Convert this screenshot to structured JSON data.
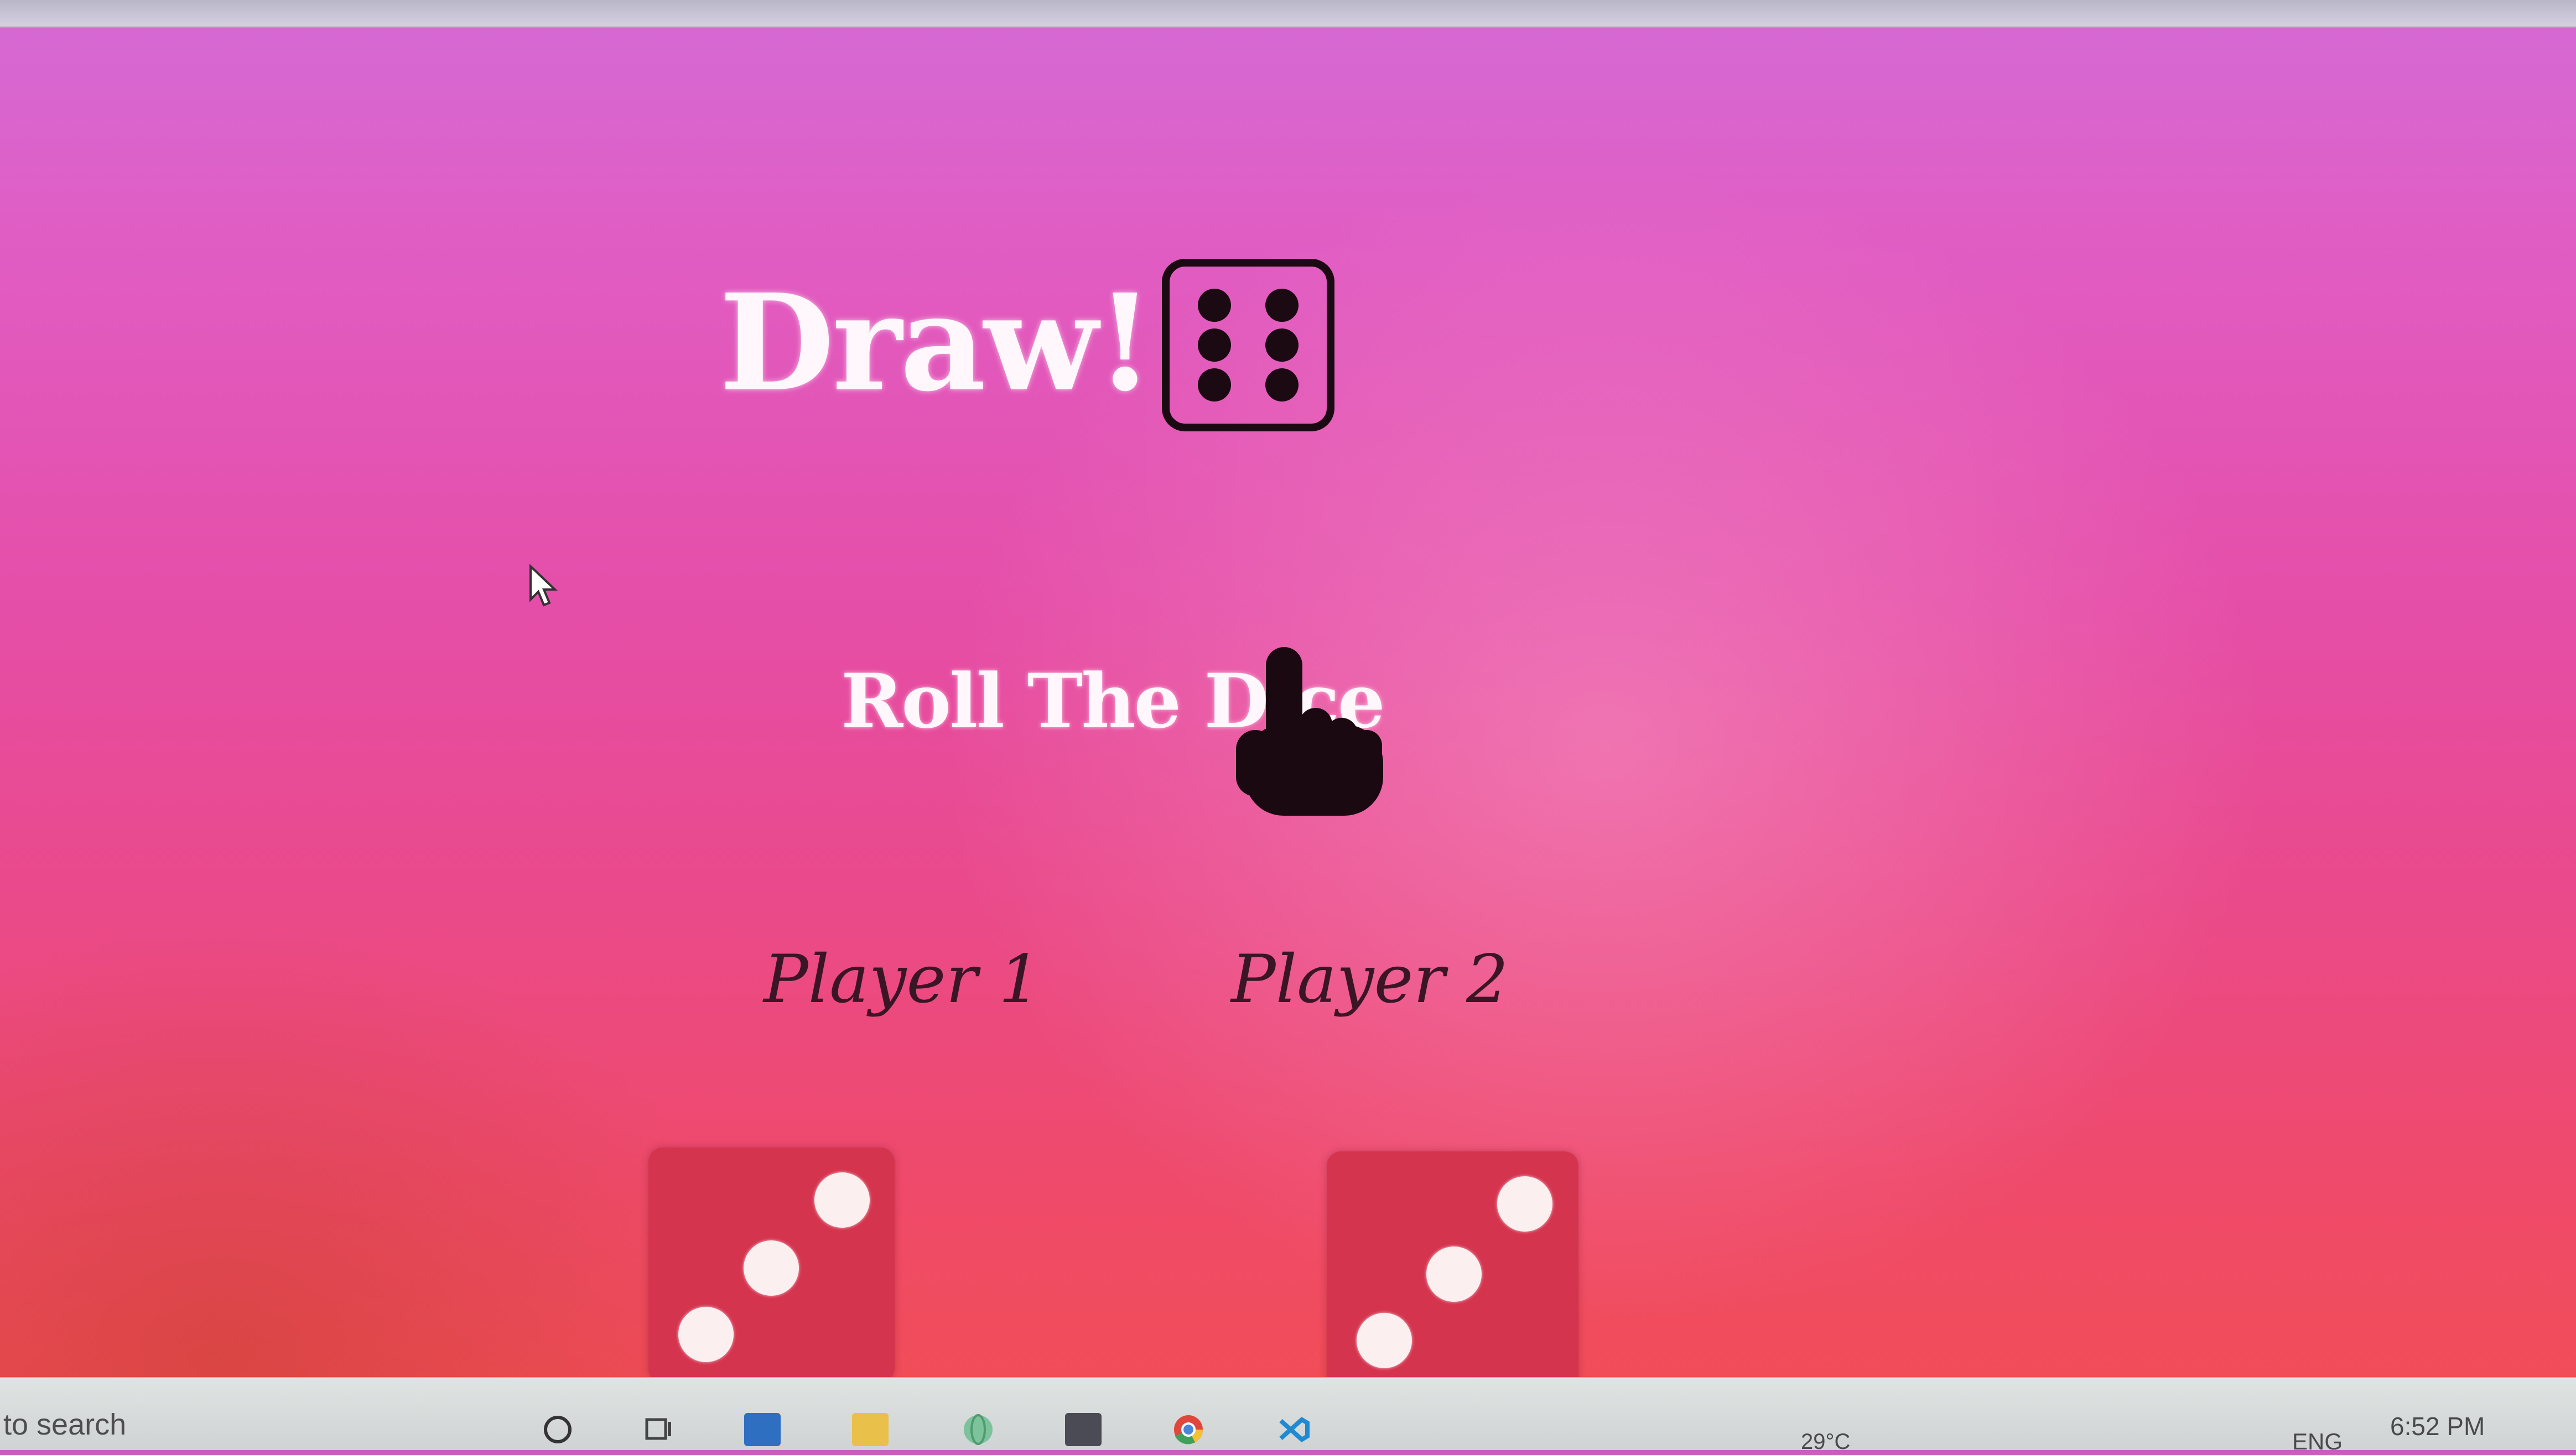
{
  "game": {
    "result": "Draw!",
    "roll_button_label": "Roll The Dice",
    "result_die_face": 6
  },
  "players": [
    {
      "name": "Player 1",
      "die_face": 3
    },
    {
      "name": "Player 2",
      "die_face": 3
    }
  ],
  "taskbar": {
    "search_text": "to search",
    "weather": "29°C",
    "language": "ENG",
    "time": "6:52 PM",
    "apps": [
      "cortana-icon",
      "task-view-icon",
      "store-icon",
      "file-explorer-icon",
      "globe-icon",
      "notes-icon",
      "chrome-icon",
      "vscode-icon"
    ]
  },
  "colors": {
    "background_top": "#d56ad6",
    "background_bottom": "#f24e52",
    "die_red": "#d5344e",
    "ink_dark": "#1b0a12"
  }
}
